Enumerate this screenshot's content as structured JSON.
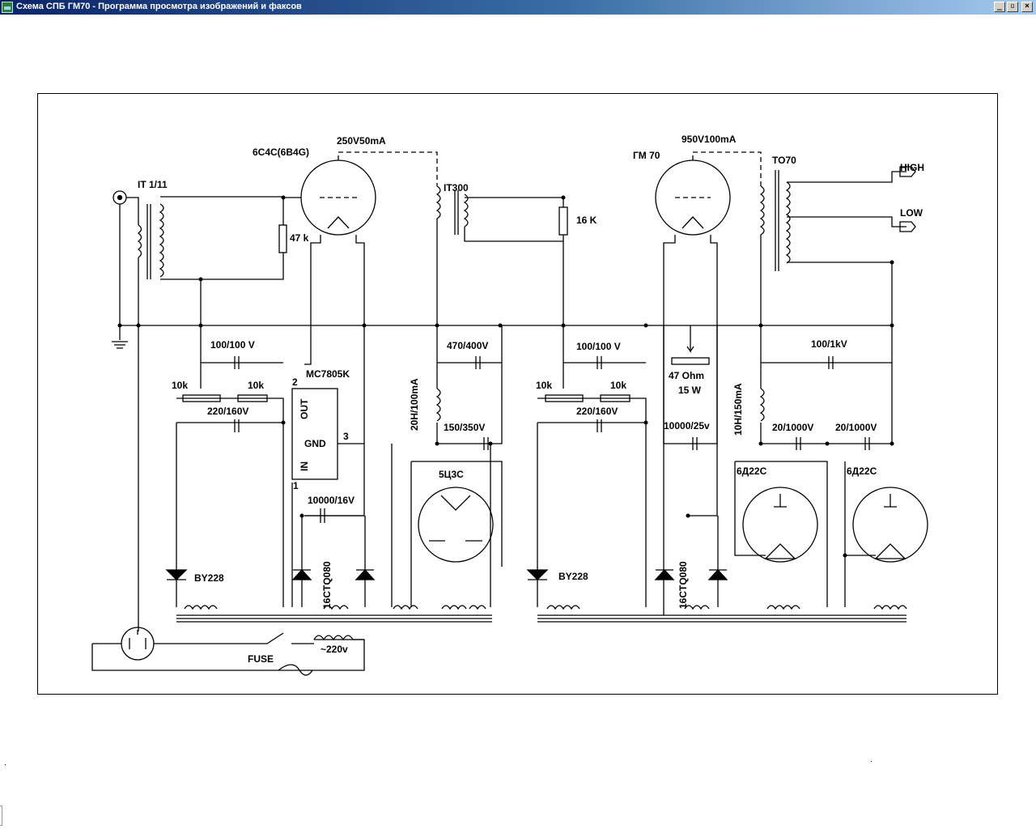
{
  "window": {
    "title": "Схема СПБ ГМ70 - Программа просмотра изображений и факсов",
    "controls": {
      "minimize": "_",
      "restore": "▫",
      "close": "×"
    }
  },
  "schematic": {
    "labels": {
      "tube1": "6C4C(6B4G)",
      "tube1_supply": "250V50mA",
      "input_transformer": "IT 1/11",
      "r47k": "47 k",
      "interstage": "IT300",
      "r16k": "16 K",
      "tube2": "ГМ 70",
      "tube2_supply": "950V100mA",
      "output_transformer": "TO70",
      "out_high": "HIGH",
      "out_low": "LOW",
      "cap_100_100_left": "100/100 V",
      "pot_10k_a": "10k",
      "pot_10k_b": "10k",
      "cap_220_160_left": "220/160V",
      "regulator": "MC7805K",
      "reg_out": "OUT",
      "reg_gnd": "GND",
      "reg_in": "IN",
      "pin2": "2",
      "pin3": "3",
      "pin1": "1",
      "cap_10000_16": "10000/16V",
      "diode_left": "BY228",
      "diode_pair_left": "16CTQ080",
      "cap_470_400": "470/400V",
      "choke_20h": "20H/100mA",
      "cap_150_350": "150/350V",
      "rectifier_5c3c": "5Ц3С",
      "cap_100_100_right": "100/100 V",
      "pot_10k_c": "10k",
      "pot_10k_d": "10k",
      "cap_220_160_right": "220/160V",
      "diode_right": "BY228",
      "r47ohm": "47 Ohm",
      "r47ohm_w": "15 W",
      "cap_10000_25": "10000/25v",
      "diode_pair_right": "16CTQ080",
      "choke_10h": "10H/150mA",
      "cap_100_1k": "100/1kV",
      "cap_20_1000_a": "20/1000V",
      "cap_20_1000_b": "20/1000V",
      "rect_6d22c_a": "6Д22С",
      "rect_6d22c_b": "6Д22С",
      "fuse": "FUSE",
      "mains": "~220v"
    }
  }
}
